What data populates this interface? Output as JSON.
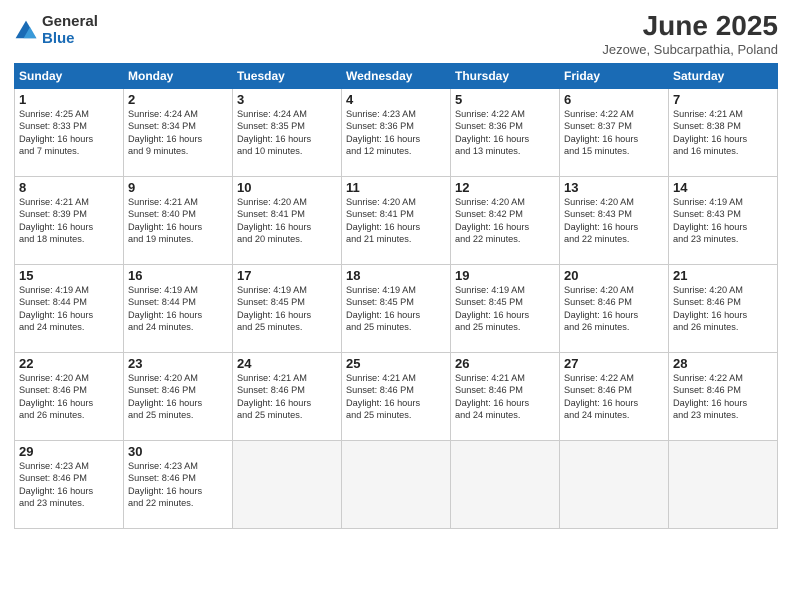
{
  "logo": {
    "general": "General",
    "blue": "Blue"
  },
  "title": "June 2025",
  "subtitle": "Jezowe, Subcarpathia, Poland",
  "headers": [
    "Sunday",
    "Monday",
    "Tuesday",
    "Wednesday",
    "Thursday",
    "Friday",
    "Saturday"
  ],
  "weeks": [
    [
      {
        "day": "1",
        "info": "Sunrise: 4:25 AM\nSunset: 8:33 PM\nDaylight: 16 hours\nand 7 minutes."
      },
      {
        "day": "2",
        "info": "Sunrise: 4:24 AM\nSunset: 8:34 PM\nDaylight: 16 hours\nand 9 minutes."
      },
      {
        "day": "3",
        "info": "Sunrise: 4:24 AM\nSunset: 8:35 PM\nDaylight: 16 hours\nand 10 minutes."
      },
      {
        "day": "4",
        "info": "Sunrise: 4:23 AM\nSunset: 8:36 PM\nDaylight: 16 hours\nand 12 minutes."
      },
      {
        "day": "5",
        "info": "Sunrise: 4:22 AM\nSunset: 8:36 PM\nDaylight: 16 hours\nand 13 minutes."
      },
      {
        "day": "6",
        "info": "Sunrise: 4:22 AM\nSunset: 8:37 PM\nDaylight: 16 hours\nand 15 minutes."
      },
      {
        "day": "7",
        "info": "Sunrise: 4:21 AM\nSunset: 8:38 PM\nDaylight: 16 hours\nand 16 minutes."
      }
    ],
    [
      {
        "day": "8",
        "info": "Sunrise: 4:21 AM\nSunset: 8:39 PM\nDaylight: 16 hours\nand 18 minutes."
      },
      {
        "day": "9",
        "info": "Sunrise: 4:21 AM\nSunset: 8:40 PM\nDaylight: 16 hours\nand 19 minutes."
      },
      {
        "day": "10",
        "info": "Sunrise: 4:20 AM\nSunset: 8:41 PM\nDaylight: 16 hours\nand 20 minutes."
      },
      {
        "day": "11",
        "info": "Sunrise: 4:20 AM\nSunset: 8:41 PM\nDaylight: 16 hours\nand 21 minutes."
      },
      {
        "day": "12",
        "info": "Sunrise: 4:20 AM\nSunset: 8:42 PM\nDaylight: 16 hours\nand 22 minutes."
      },
      {
        "day": "13",
        "info": "Sunrise: 4:20 AM\nSunset: 8:43 PM\nDaylight: 16 hours\nand 22 minutes."
      },
      {
        "day": "14",
        "info": "Sunrise: 4:19 AM\nSunset: 8:43 PM\nDaylight: 16 hours\nand 23 minutes."
      }
    ],
    [
      {
        "day": "15",
        "info": "Sunrise: 4:19 AM\nSunset: 8:44 PM\nDaylight: 16 hours\nand 24 minutes."
      },
      {
        "day": "16",
        "info": "Sunrise: 4:19 AM\nSunset: 8:44 PM\nDaylight: 16 hours\nand 24 minutes."
      },
      {
        "day": "17",
        "info": "Sunrise: 4:19 AM\nSunset: 8:45 PM\nDaylight: 16 hours\nand 25 minutes."
      },
      {
        "day": "18",
        "info": "Sunrise: 4:19 AM\nSunset: 8:45 PM\nDaylight: 16 hours\nand 25 minutes."
      },
      {
        "day": "19",
        "info": "Sunrise: 4:19 AM\nSunset: 8:45 PM\nDaylight: 16 hours\nand 25 minutes."
      },
      {
        "day": "20",
        "info": "Sunrise: 4:20 AM\nSunset: 8:46 PM\nDaylight: 16 hours\nand 26 minutes."
      },
      {
        "day": "21",
        "info": "Sunrise: 4:20 AM\nSunset: 8:46 PM\nDaylight: 16 hours\nand 26 minutes."
      }
    ],
    [
      {
        "day": "22",
        "info": "Sunrise: 4:20 AM\nSunset: 8:46 PM\nDaylight: 16 hours\nand 26 minutes."
      },
      {
        "day": "23",
        "info": "Sunrise: 4:20 AM\nSunset: 8:46 PM\nDaylight: 16 hours\nand 25 minutes."
      },
      {
        "day": "24",
        "info": "Sunrise: 4:21 AM\nSunset: 8:46 PM\nDaylight: 16 hours\nand 25 minutes."
      },
      {
        "day": "25",
        "info": "Sunrise: 4:21 AM\nSunset: 8:46 PM\nDaylight: 16 hours\nand 25 minutes."
      },
      {
        "day": "26",
        "info": "Sunrise: 4:21 AM\nSunset: 8:46 PM\nDaylight: 16 hours\nand 24 minutes."
      },
      {
        "day": "27",
        "info": "Sunrise: 4:22 AM\nSunset: 8:46 PM\nDaylight: 16 hours\nand 24 minutes."
      },
      {
        "day": "28",
        "info": "Sunrise: 4:22 AM\nSunset: 8:46 PM\nDaylight: 16 hours\nand 23 minutes."
      }
    ],
    [
      {
        "day": "29",
        "info": "Sunrise: 4:23 AM\nSunset: 8:46 PM\nDaylight: 16 hours\nand 23 minutes."
      },
      {
        "day": "30",
        "info": "Sunrise: 4:23 AM\nSunset: 8:46 PM\nDaylight: 16 hours\nand 22 minutes."
      },
      {
        "day": "",
        "info": ""
      },
      {
        "day": "",
        "info": ""
      },
      {
        "day": "",
        "info": ""
      },
      {
        "day": "",
        "info": ""
      },
      {
        "day": "",
        "info": ""
      }
    ]
  ]
}
